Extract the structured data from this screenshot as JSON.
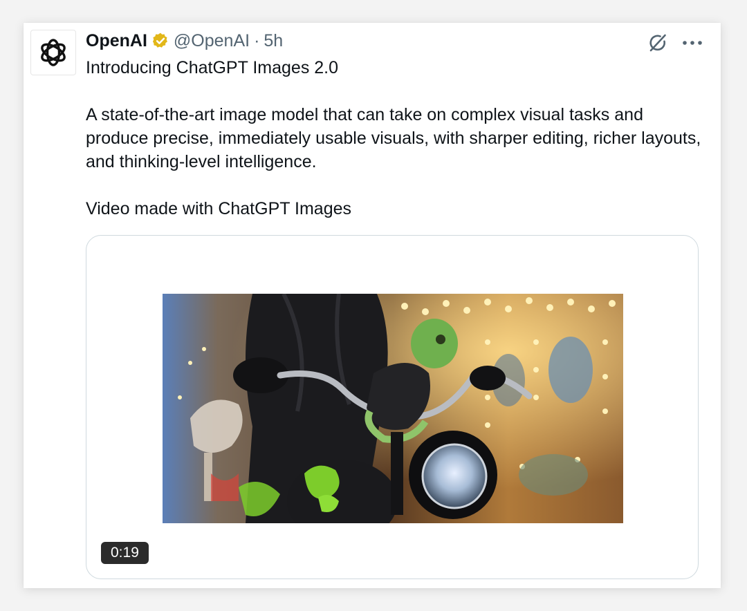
{
  "tweet": {
    "author_name": "OpenAI",
    "handle": "@OpenAI",
    "separator": "·",
    "time_ago": "5h",
    "verified_color": "#E2B719",
    "paragraphs": [
      "Introducing ChatGPT Images 2.0",
      "A state-of-the-art image model that can take on complex visual tasks and produce precise, immediately usable visuals, with sharper editing, richer layouts, and thinking-level intelligence.",
      "Video made with ChatGPT Images"
    ]
  },
  "media": {
    "type": "video",
    "duration": "0:19"
  },
  "icons": {
    "avatar": "openai-logo-icon",
    "verified": "verified-badge-icon",
    "grok": "grok-icon",
    "more": "more-options-icon"
  }
}
